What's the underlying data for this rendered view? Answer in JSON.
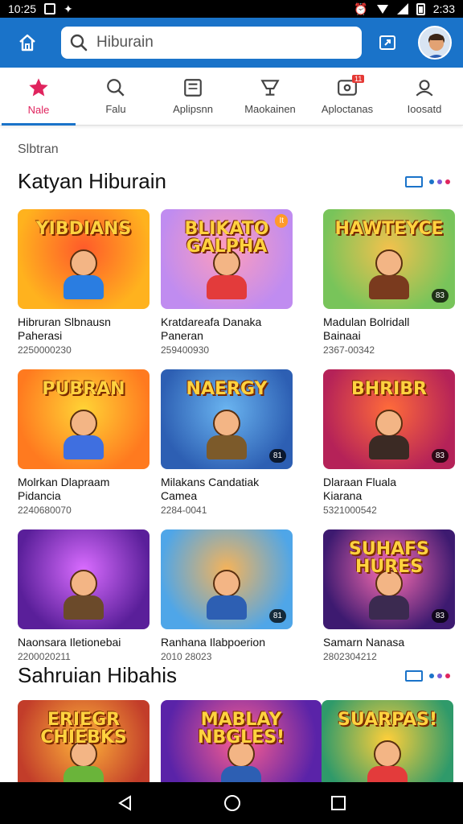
{
  "status_bar": {
    "time": "10:25",
    "battery": "2:33"
  },
  "search": {
    "placeholder": "Hiburain"
  },
  "tabs": [
    {
      "label": "Nale",
      "icon": "star-icon",
      "active": true
    },
    {
      "label": "Falu",
      "icon": "search-icon"
    },
    {
      "label": "Aplipsnn",
      "icon": "document-icon"
    },
    {
      "label": "Maokainen",
      "icon": "cup-icon"
    },
    {
      "label": "Aploctanas",
      "icon": "app-icon",
      "badge": "11"
    },
    {
      "label": "Ioosatd",
      "icon": "person-icon"
    }
  ],
  "breadcrumb": "Slbtran",
  "sections": [
    {
      "title": "Katyan Hiburain",
      "cards": [
        {
          "thumb_text": "YIBDIANS",
          "name": "Hibruran Slbnausn",
          "name2": "Paherasi",
          "meta": "2250000230",
          "colors": [
            "#ffb21e",
            "#ff5a2a"
          ],
          "shirt": "#2a7de1"
        },
        {
          "thumb_text": "BLIKATO GALPHA",
          "name": "Kratdareafa Danaka",
          "name2": "Paneran",
          "meta": "259400930",
          "colors": [
            "#c08cf0",
            "#ff9dbb"
          ],
          "shirt": "#e33b3b",
          "badge_tl": "It"
        },
        {
          "thumb_text": "HAWTEYCE",
          "name": "Madulan Bolridall",
          "name2": "Bainaai",
          "meta": "2367-00342",
          "colors": [
            "#78c45a",
            "#f3c14d"
          ],
          "shirt": "#7a3a1e",
          "badge": "83"
        },
        {
          "thumb_text": "PUBRAN",
          "name": "Molrkan Dlapraam",
          "name2": "Pidancia",
          "meta": "2240680070",
          "colors": [
            "#ff7a1f",
            "#ffd335"
          ],
          "shirt": "#3f6fe0"
        },
        {
          "thumb_text": "NAERGY",
          "name": "Milakans Candatiak",
          "name2": "Camea",
          "meta": "2284-0041",
          "colors": [
            "#2d5fb3",
            "#6ab4f0"
          ],
          "shirt": "#7c5a2a",
          "badge": "81"
        },
        {
          "thumb_text": "BHRIBR",
          "name": "Dlaraan Fluala",
          "name2": "Kiarana",
          "meta": "5321000542",
          "colors": [
            "#b52258",
            "#ff6b3a"
          ],
          "shirt": "#3b2a24",
          "badge": "83"
        },
        {
          "thumb_text": "",
          "name": "Naonsara Iletionebai",
          "name2": "",
          "meta": "2200020211",
          "colors": [
            "#5a1f9a",
            "#d96cff"
          ],
          "shirt": "#6b4a2a"
        },
        {
          "thumb_text": "",
          "name": "Ranhana Ilabpoerion",
          "name2": "",
          "meta": "2010 28023",
          "colors": [
            "#4fa6e8",
            "#f5b35a"
          ],
          "shirt": "#2d5fb3",
          "badge": "81"
        },
        {
          "thumb_text": "SUHAFS HURES",
          "name": "Samarn Nanasa",
          "name2": "",
          "meta": "2802304212",
          "colors": [
            "#3d1a70",
            "#ff6fb2"
          ],
          "shirt": "#3b2a50",
          "badge": "83"
        }
      ]
    },
    {
      "title": "Sahruian Hibahis",
      "cards": [
        {
          "thumb_text": "ERIEGR CHIEBKS",
          "colors": [
            "#c23d2a",
            "#ffb43a"
          ],
          "shirt": "#6ab43a"
        },
        {
          "thumb_text": "MABLAY NBGLES!",
          "colors": [
            "#5a23a8",
            "#ff5f8f"
          ],
          "shirt": "#2d5fb3"
        },
        {
          "thumb_text": "SUARPAS!",
          "colors": [
            "#2f9a6a",
            "#ffcf3a"
          ],
          "shirt": "#e33b3b"
        }
      ]
    }
  ],
  "colors": {
    "appbar": "#1a73c9",
    "active_tab": "#e0245e"
  }
}
